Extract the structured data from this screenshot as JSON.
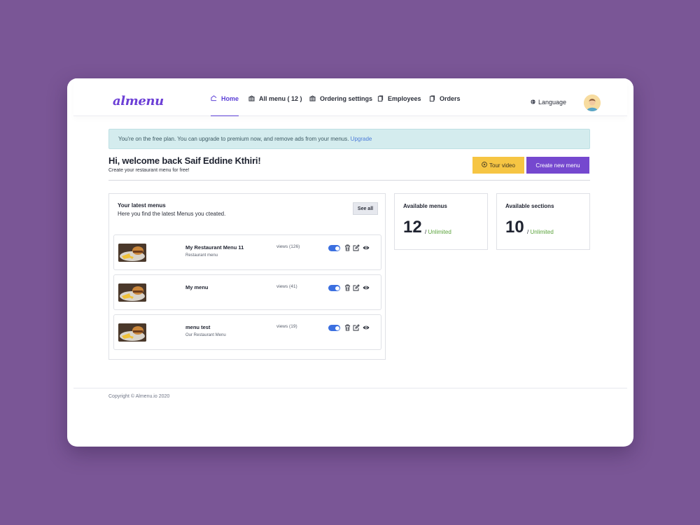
{
  "brand": {
    "logo_text": "almenu",
    "accent": "#6c3fd6",
    "background": "#7a5696"
  },
  "nav": {
    "items": [
      {
        "label": "Home",
        "icon": "home-icon",
        "active": true
      },
      {
        "label": "All menu ( 12 )",
        "icon": "book-icon",
        "active": false
      },
      {
        "label": "Ordering settings",
        "icon": "settings-icon",
        "active": false
      },
      {
        "label": "Employees",
        "icon": "clipboard-icon",
        "active": false
      },
      {
        "label": "Orders",
        "icon": "clipboard-icon",
        "active": false
      }
    ],
    "language_label": "Language"
  },
  "alert": {
    "text": "You're on the free plan. You can upgrade to premium now, and remove ads from your menus.",
    "link_label": "Upgrade"
  },
  "welcome": {
    "title": "Hi, welcome back Saif Eddine Kthiri!",
    "subtitle": "Create your restaurant menu for free!",
    "tour_button": "Tour video",
    "create_button": "Create new menu"
  },
  "latest_menus": {
    "title": "Your latest menus",
    "subtitle": "Here you find the latest Menus you cteated.",
    "see_all_label": "See all",
    "items": [
      {
        "name": "My Restaurant Menu 11",
        "description": "Restaurant menu",
        "views": "views (126)",
        "enabled": true
      },
      {
        "name": "My menu",
        "description": "",
        "views": "views (41)",
        "enabled": true
      },
      {
        "name": "menu test",
        "description": "Our Restaurant Menu",
        "views": "views (19)",
        "enabled": true
      }
    ]
  },
  "stats": {
    "menus": {
      "label": "Available menus",
      "value": "12",
      "limit_prefix": "/",
      "limit": "Unlimited"
    },
    "sections": {
      "label": "Available sections",
      "value": "10",
      "limit_prefix": "/",
      "limit": "Unlimited"
    }
  },
  "footer": {
    "copyright": "Copyright © Almenu.io 2020"
  }
}
